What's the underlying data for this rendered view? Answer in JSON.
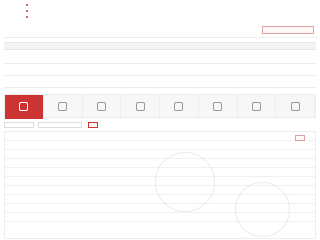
{
  "notice": {
    "tag": "",
    "lines": [
      "",
      "",
      ""
    ],
    "more_button": ""
  },
  "section_bar": {
    "label": "",
    "text": ""
  },
  "info_rows": [
    {
      "c1": "",
      "c2": "",
      "c3": "",
      "c4": ""
    },
    {
      "c1": "",
      "c2": "",
      "c3": "",
      "c4": ""
    },
    {
      "c1": "",
      "c2": "",
      "c3": "",
      "c4": ""
    }
  ],
  "tabs": [
    {
      "label": ""
    },
    {
      "label": ""
    },
    {
      "label": ""
    },
    {
      "label": ""
    },
    {
      "label": ""
    },
    {
      "label": ""
    },
    {
      "label": ""
    },
    {
      "label": ""
    }
  ],
  "filters": {
    "select1": "",
    "select2": "",
    "button": ""
  },
  "detail": {
    "button": "",
    "rows": [
      {
        "label": "",
        "value": ""
      },
      {
        "label": "",
        "value": ""
      },
      {
        "label": "",
        "value": ""
      },
      {
        "label": "",
        "value": ""
      },
      {
        "label": "",
        "value": ""
      },
      {
        "label": "",
        "value": ""
      },
      {
        "label": "",
        "value": ""
      },
      {
        "label": "",
        "value": ""
      },
      {
        "label": "",
        "value": ""
      },
      {
        "label": "",
        "value": ""
      }
    ]
  },
  "colors": {
    "accent": "#cc3333",
    "active_tab_bg": "#cc3333"
  }
}
